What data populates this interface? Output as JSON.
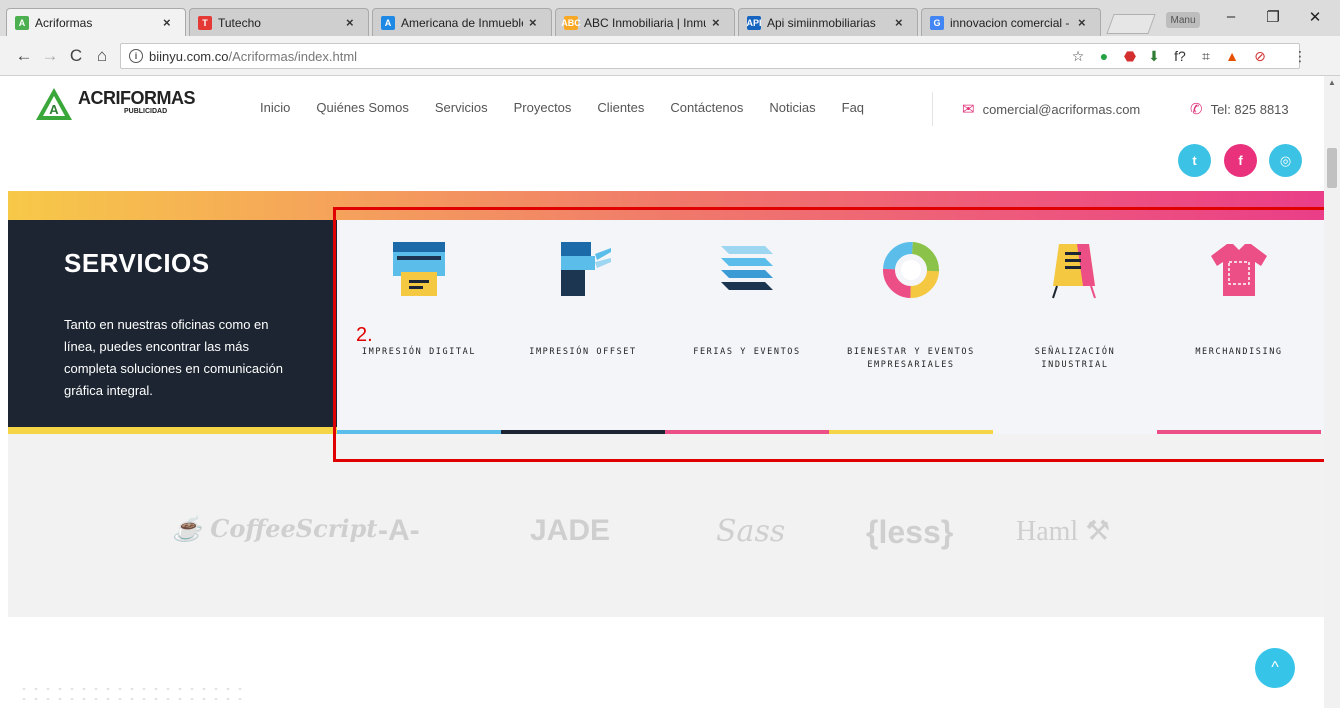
{
  "browser": {
    "tabs": [
      {
        "title": "Acriformas",
        "fav_color": "#4caf50",
        "fav_glyph": "A"
      },
      {
        "title": "Tutecho",
        "fav_color": "#e53935",
        "fav_glyph": "T"
      },
      {
        "title": "Americana de Inmueble",
        "fav_color": "#1e88e5",
        "fav_glyph": "A"
      },
      {
        "title": "ABC Inmobiliaria | Inmu",
        "fav_color": "#f9a825",
        "fav_glyph": "ABC"
      },
      {
        "title": "Api simiinmobiliarias",
        "fav_color": "#1565c0",
        "fav_glyph": "API"
      },
      {
        "title": "innovacion comercial - I",
        "fav_color": "#4285f4",
        "fav_glyph": "G"
      }
    ],
    "close_glyph": "×",
    "user_label": "Manu",
    "window_buttons": {
      "minimize": "–",
      "maximize": "❐",
      "close": "✕"
    },
    "nav": {
      "back": "←",
      "forward": "→",
      "reload": "C",
      "home": "⌂"
    },
    "url_host": "biinyu.com.co",
    "url_path": "/Acriformas/index.html",
    "info_glyph": "i",
    "toolbar_icons": [
      {
        "name": "bookmark-star-icon",
        "glyph": "☆",
        "color": "#444"
      },
      {
        "name": "whatsapp-extension-icon",
        "glyph": "●",
        "color": "#25a244"
      },
      {
        "name": "adblock-extension-icon",
        "glyph": "⬣",
        "color": "#d32f2f"
      },
      {
        "name": "download-extension-icon",
        "glyph": "⬇",
        "color": "#2e7d32"
      },
      {
        "name": "font-extension-icon",
        "glyph": "f?",
        "color": "#333"
      },
      {
        "name": "screenshot-extension-icon",
        "glyph": "⌗",
        "color": "#444"
      },
      {
        "name": "brush-extension-icon",
        "glyph": "▲",
        "color": "#e65100"
      },
      {
        "name": "block-extension-icon",
        "glyph": "⊘",
        "color": "#d32f2f"
      },
      {
        "name": "menu-dots-icon",
        "glyph": "⋮",
        "color": "#444"
      }
    ]
  },
  "site": {
    "logo": {
      "name": "ACRIFORMAS",
      "sub": "PUBLICIDAD"
    },
    "menu": [
      "Inicio",
      "Quiénes Somos",
      "Servicios",
      "Proyectos",
      "Clientes",
      "Contáctenos",
      "Noticias",
      "Faq"
    ],
    "email": "comercial@acriformas.com",
    "phone": "Tel: 825 8813",
    "social": [
      {
        "name": "twitter",
        "glyph": "t",
        "color": "#3cc2e4"
      },
      {
        "name": "facebook",
        "glyph": "f",
        "color": "#e9317c"
      },
      {
        "name": "instagram",
        "glyph": "◎",
        "color": "#3cc2e4"
      }
    ]
  },
  "services_panel": {
    "title": "SERVICIOS",
    "text": "Tanto en nuestras oficinas como en línea, puedes encontrar las más completa soluciones en comunicación gráfica integral."
  },
  "services": [
    {
      "label": "IMPRESIÓN DIGITAL",
      "icon": "printer-icon",
      "underline": "#5bbde9"
    },
    {
      "label": "IMPRESIÓN OFFSET",
      "icon": "offset-press-icon",
      "underline": "#1c2531"
    },
    {
      "label": "FERIAS Y EVENTOS",
      "icon": "layers-icon",
      "underline": "#ec4f86"
    },
    {
      "label": "BIENESTAR Y EVENTOS EMPRESARIALES",
      "icon": "donut-icon",
      "underline": "#f5d546"
    },
    {
      "label": "SEÑALIZACIÓN INDUSTRIAL",
      "icon": "sign-board-icon",
      "underline": ""
    },
    {
      "label": "MERCHANDISING",
      "icon": "tshirt-icon",
      "underline": "#ec4f86"
    }
  ],
  "annotation": {
    "label": "2."
  },
  "tech_logos": [
    "CoffeeScript",
    "-A-",
    "JADE",
    "Sass",
    "{less}",
    "Haml"
  ],
  "back_to_top_glyph": "^"
}
